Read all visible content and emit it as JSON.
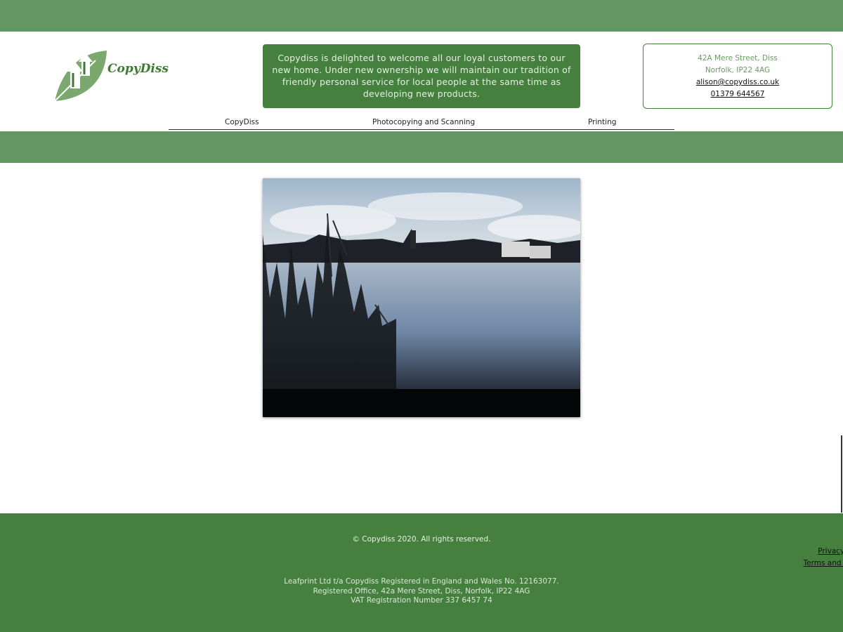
{
  "logo": {
    "text": "CopyDiss",
    "icon": "leaf-arrows-logo-icon",
    "brand_color": "#45803f"
  },
  "welcome": {
    "text": "Copydiss is delighted to welcome all our loyal customers to our new home. Under new ownership we will maintain our tradition of friendly personal service for local people at the same time as developing new products."
  },
  "contact": {
    "address_line1": "42A Mere Street, Diss",
    "address_line2": "Norfolk, IP22 4AG",
    "email": "alison@copydiss.co.uk",
    "phone": "01379 644567"
  },
  "nav": {
    "items": [
      {
        "label": "CopyDiss"
      },
      {
        "label": "Photocopying and Scanning"
      },
      {
        "label": "Printing"
      }
    ]
  },
  "hero": {
    "image": "mere-lake-reeds-photo"
  },
  "footer": {
    "copyright": "© Copydiss 2020. All rights reserved.",
    "privacy": "Privacy Policy",
    "terms": "Terms and Conditions",
    "reg_line1": "Leafprint Ltd t/a Copydiss Registered in England and Wales No. 12163077.",
    "reg_line2": "Registered Office, 42a Mere Street, Diss, Norfolk, IP22 4AG",
    "reg_line3": "VAT Registration Number 337 6457 74"
  },
  "colors": {
    "band": "#659764",
    "dark_green": "#45803f"
  }
}
